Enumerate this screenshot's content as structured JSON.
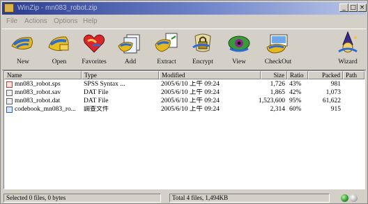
{
  "window": {
    "title": "WinZip - mn083_robot.zip",
    "minimize_glyph": "_",
    "maximize_glyph": "□",
    "close_glyph": "×"
  },
  "menu": [
    "File",
    "Actions",
    "Options",
    "Help"
  ],
  "toolbar": [
    {
      "label": "New",
      "icon": "new-archive-icon"
    },
    {
      "label": "Open",
      "icon": "open-archive-icon"
    },
    {
      "label": "Favorites",
      "icon": "favorites-icon"
    },
    {
      "label": "Add",
      "icon": "add-icon"
    },
    {
      "label": "Extract",
      "icon": "extract-icon"
    },
    {
      "label": "Encrypt",
      "icon": "encrypt-icon"
    },
    {
      "label": "View",
      "icon": "view-icon"
    },
    {
      "label": "CheckOut",
      "icon": "checkout-icon"
    },
    {
      "label": "Wizard",
      "icon": "wizard-icon"
    }
  ],
  "columns": [
    "Name",
    "Type",
    "Modified",
    "Size",
    "Ratio",
    "Packed",
    "Path"
  ],
  "files": [
    {
      "name": "mn083_robot.sps",
      "type": "SPSS Syntax ...",
      "modified": "2005/6/10 上午 09:24",
      "size": "1,726",
      "ratio": "43%",
      "packed": "981",
      "path": "",
      "icon": "spss-syntax-file-icon",
      "icon_color": "#c0392b"
    },
    {
      "name": "mn083_robot.sav",
      "type": "DAT File",
      "modified": "2005/6/10 上午 09:24",
      "size": "1,865",
      "ratio": "42%",
      "packed": "1,073",
      "path": "",
      "icon": "data-file-icon",
      "icon_color": "#606060"
    },
    {
      "name": "mn083_robot.dat",
      "type": "DAT File",
      "modified": "2005/6/10 上午 09:24",
      "size": "1,523,600",
      "ratio": "95%",
      "packed": "61,622",
      "path": "",
      "icon": "data-file-icon",
      "icon_color": "#606060"
    },
    {
      "name": "codebook_mn083_ro...",
      "type": "調查文件",
      "modified": "2005/6/10 上午 09:24",
      "size": "2,314",
      "ratio": "60%",
      "packed": "915",
      "path": "",
      "icon": "document-file-icon",
      "icon_color": "#2a5bd7"
    }
  ],
  "status": {
    "selected": "Selected 0 files, 0 bytes",
    "total": "Total 4 files, 1,494KB"
  }
}
